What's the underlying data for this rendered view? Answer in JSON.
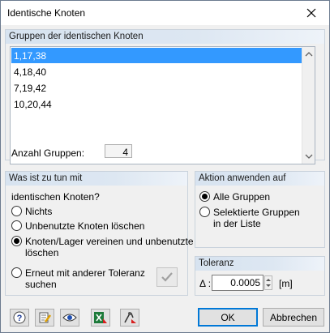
{
  "window": {
    "title": "Identische Knoten"
  },
  "groups_panel": {
    "header": "Gruppen der identischen Knoten",
    "items": [
      "1,17,38",
      "4,18,40",
      "7,19,42",
      "10,20,44"
    ],
    "selected_index": 0,
    "count_label": "Anzahl Gruppen:",
    "count_value": "4"
  },
  "action_panel": {
    "header": "Was ist zu tun mit",
    "subtitle": "identischen Knoten?",
    "options": [
      {
        "label": "Nichts",
        "checked": false
      },
      {
        "label": "Unbenutzte Knoten löschen",
        "checked": false
      },
      {
        "label_line1": "Knoten/Lager vereinen und unbenutzte",
        "label_line2": "löschen",
        "checked": true
      },
      {
        "label_line1": "Erneut mit anderer Toleranz",
        "label_line2": "suchen",
        "checked": false
      }
    ]
  },
  "apply_panel": {
    "header": "Aktion anwenden auf",
    "options": [
      {
        "label": "Alle Gruppen",
        "checked": true
      },
      {
        "label_line1": "Selektierte Gruppen",
        "label_line2": "in der Liste",
        "checked": false
      }
    ]
  },
  "tolerance_panel": {
    "header": "Toleranz",
    "delta_label": "Δ :",
    "value": "0.0005",
    "unit": "[m]"
  },
  "footer": {
    "ok_label": "OK",
    "cancel_label": "Abbrechen"
  },
  "colors": {
    "selection": "#3399ff",
    "header_gradient_start": "#d7e3f0",
    "default_button_border": "#0078d7"
  }
}
